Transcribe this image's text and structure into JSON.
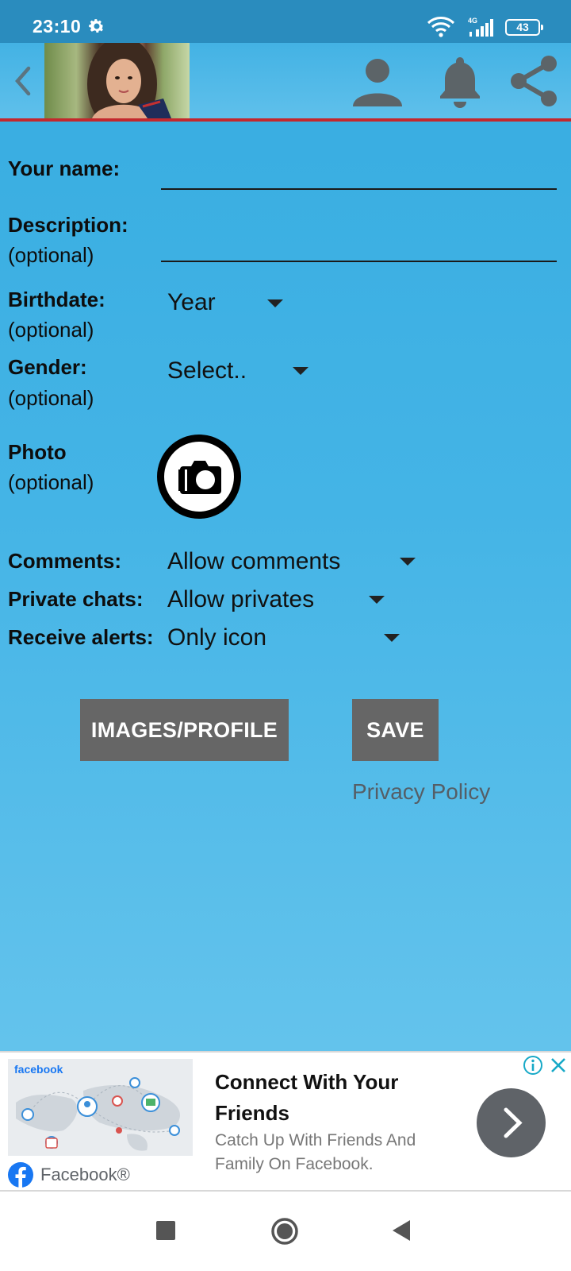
{
  "status_bar": {
    "time": "23:10",
    "network_type": "4G",
    "battery_level": "43",
    "icons": [
      "gear-icon",
      "wifi-icon",
      "signal-icon",
      "battery-icon"
    ]
  },
  "header": {
    "icons": [
      "chevron-left-icon",
      "person-icon",
      "bell-icon",
      "share-icon"
    ]
  },
  "form": {
    "name": {
      "label": "Your name:",
      "value": ""
    },
    "description": {
      "label": "Description:",
      "sub": "(optional)",
      "value": ""
    },
    "birthdate": {
      "label": "Birthdate:",
      "sub": "(optional)",
      "value": "Year"
    },
    "gender": {
      "label": "Gender:",
      "sub": "(optional)",
      "value": "Select.."
    },
    "photo": {
      "label": "Photo",
      "sub": "(optional)",
      "icon": "camera-icon"
    },
    "comments": {
      "label": "Comments:",
      "value": "Allow comments"
    },
    "private_chats": {
      "label": "Private chats:",
      "value": "Allow privates"
    },
    "receive_alerts": {
      "label": "Receive alerts:",
      "value": "Only icon"
    }
  },
  "actions": {
    "images_profile": "IMAGES/PROFILE",
    "save": "SAVE",
    "privacy_policy": "Privacy Policy"
  },
  "ad": {
    "wordmark": "facebook",
    "title": "Connect With Your Friends",
    "description": "Catch Up With Friends And Family On Facebook.",
    "brand": "Facebook®",
    "icons": [
      "info-icon",
      "close-icon",
      "chevron-right-icon",
      "facebook-logo-icon"
    ]
  },
  "colors": {
    "background_top": "#36ace0",
    "background_bottom": "#6cc6ee",
    "header_rule": "#c3282e",
    "button_gray": "#666666",
    "ad_info_blue": "#17a9c7"
  }
}
